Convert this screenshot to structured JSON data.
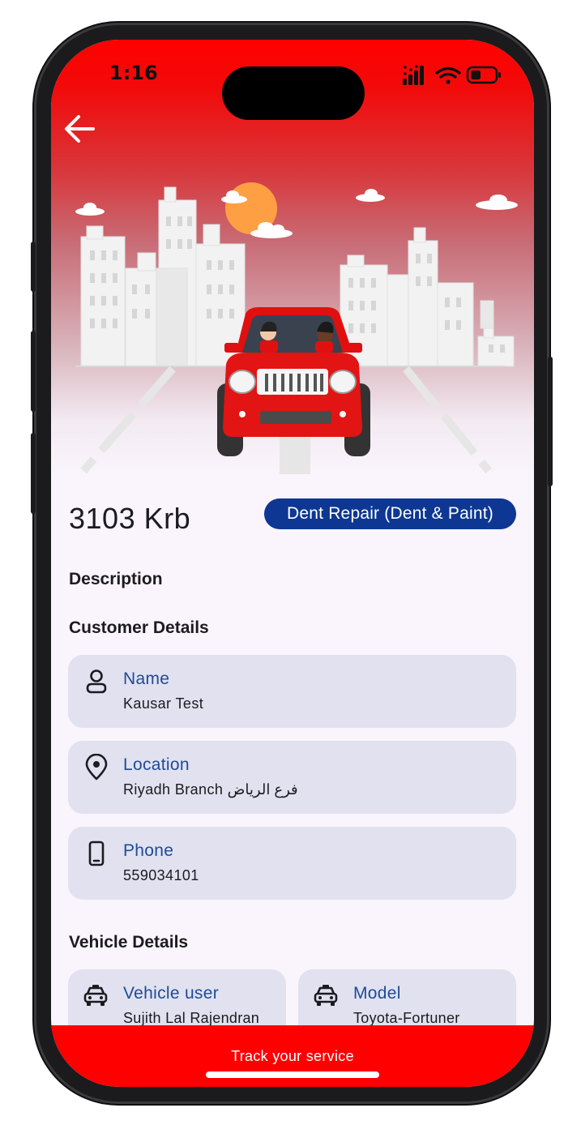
{
  "status_bar": {
    "time": "1:16"
  },
  "header": {
    "back_icon": "arrow-left-icon"
  },
  "job": {
    "plate": "3103 Krb",
    "service_type": "Dent Repair (Dent & Paint)"
  },
  "sections": {
    "description_title": "Description",
    "customer_title": "Customer Details",
    "vehicle_title": "Vehicle Details"
  },
  "customer": [
    {
      "icon": "person-icon",
      "label": "Name",
      "value": "Kausar Test"
    },
    {
      "icon": "location-pin-icon",
      "label": "Location",
      "value": "Riyadh Branch فرع الرياض"
    },
    {
      "icon": "phone-icon",
      "label": "Phone",
      "value": "559034101"
    }
  ],
  "vehicle": [
    {
      "icon": "car-icon",
      "label": "Vehicle user",
      "value": "Sujith Lal Rajendran"
    },
    {
      "icon": "car-icon",
      "label": "Model",
      "value": "Toyota-Fortuner"
    }
  ],
  "footer": {
    "track_label": "Track your service"
  },
  "colors": {
    "brand_red": "#ff0000",
    "badge_blue": "#0d3792",
    "label_blue": "#1e4b97",
    "card_bg": "#e1e1f0",
    "page_bg": "#faf5fc"
  }
}
